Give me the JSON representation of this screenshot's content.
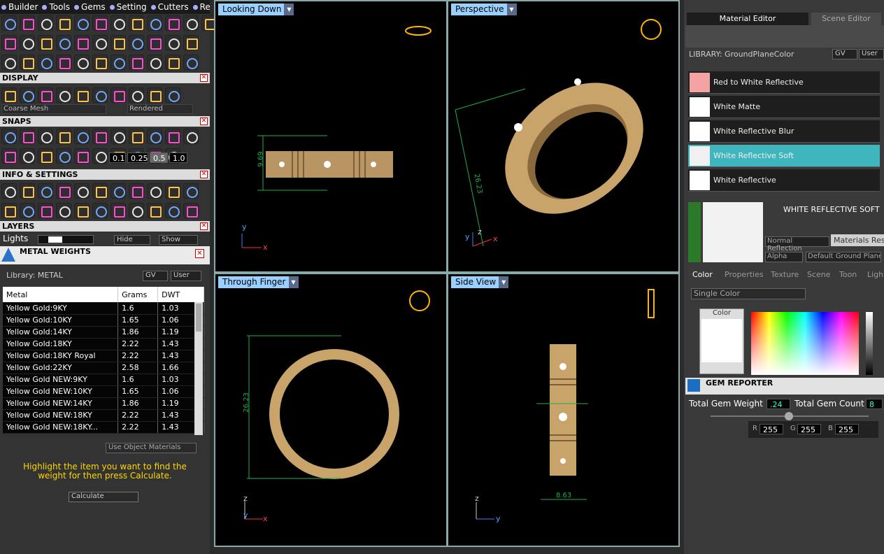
{
  "menu": [
    "Builder",
    "Tools",
    "Gems",
    "Setting",
    "Cutters",
    "Render"
  ],
  "display": {
    "title": "DISPLAY",
    "mesh": "Coarse Mesh",
    "render_mode": "Rendered"
  },
  "snaps": {
    "title": "SNAPS",
    "values": [
      "0.1",
      "0.25",
      "0.5",
      "1.0"
    ]
  },
  "info_title": "INFO & SETTINGS",
  "layers": {
    "title": "LAYERS",
    "lights": "Lights",
    "hide": "Hide",
    "show": "Show"
  },
  "metal": {
    "title": "METAL WEIGHTS",
    "library": "Library: METAL",
    "gv": "GV",
    "user": "User",
    "columns": [
      "Metal",
      "Grams",
      "DWT"
    ],
    "rows": [
      [
        "Yellow Gold:9KY",
        "1.6",
        "1.03"
      ],
      [
        "Yellow Gold:10KY",
        "1.65",
        "1.06"
      ],
      [
        "Yellow Gold:14KY",
        "1.86",
        "1.19"
      ],
      [
        "Yellow Gold:18KY",
        "2.22",
        "1.43"
      ],
      [
        "Yellow Gold:18KY Royal",
        "2.22",
        "1.43"
      ],
      [
        "Yellow Gold:22KY",
        "2.58",
        "1.66"
      ],
      [
        "Yellow Gold NEW:9KY",
        "1.6",
        "1.03"
      ],
      [
        "Yellow Gold NEW:10KY",
        "1.65",
        "1.06"
      ],
      [
        "Yellow Gold NEW:14KY",
        "1.86",
        "1.19"
      ],
      [
        "Yellow Gold NEW:18KY",
        "2.22",
        "1.43"
      ],
      [
        "Yellow Gold NEW:18KY...",
        "2.22",
        "1.43"
      ]
    ],
    "use_object": "Use Object Materials",
    "hint": "Highlight the item you want to find the weight for then press Calculate.",
    "calculate": "Calculate"
  },
  "views": {
    "tl": {
      "label": "Looking Down",
      "dim": "9.69",
      "ax1": "y",
      "ax2": "x"
    },
    "tr": {
      "label": "Perspective",
      "dim": "26.23",
      "ax1": "z",
      "ax2": "y",
      "ax3": "x"
    },
    "bl": {
      "label": "Through Finger",
      "dim": "26.23",
      "ax1": "z",
      "ax2": "y",
      "ax3": "x"
    },
    "br": {
      "label": "Side View",
      "dim": "8.63",
      "ax1": "z",
      "ax2": "y"
    }
  },
  "right": {
    "tabs": [
      "Material Editor",
      "Scene Editor"
    ],
    "library": "LIBRARY: GroundPlaneColor",
    "gv": "GV",
    "user": "User",
    "materials": [
      "Red to White Reflective",
      "White Matte",
      "White Reflective Blur",
      "White Reflective Soft",
      "White Reflective"
    ],
    "selected_name": "WHITE REFLECTIVE SOFT",
    "tooltip": "Materials Rese",
    "normal_reflection": "Normal Reflection",
    "alpha": "Alpha",
    "default_ground": "Default Ground Plane",
    "subtabs": [
      "Color",
      "Properties",
      "Texture",
      "Scene",
      "Toon",
      "Ligh"
    ],
    "single_color": "Single Color",
    "color_label": "Color",
    "gem_title": "GEM REPORTER",
    "total_weight_label": "Total Gem Weight",
    "total_weight": ".24",
    "total_count_label": "Total Gem Count",
    "total_count": "8",
    "r": "R",
    "rv": "255",
    "g": "G",
    "gv2": "255",
    "b": "B",
    "bv": "255"
  },
  "colors": {
    "gold": "#c9a46a",
    "teal": "#3fb6bd",
    "dim_green": "#1fae4a"
  }
}
